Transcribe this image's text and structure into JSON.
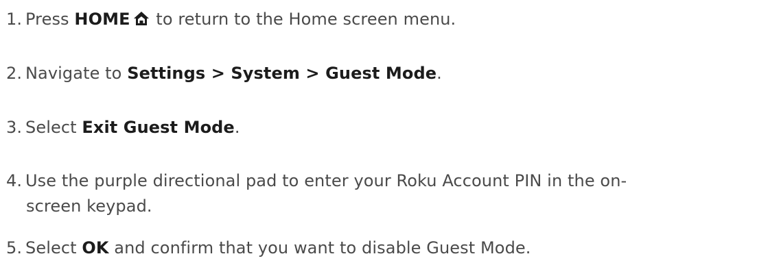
{
  "steps": [
    {
      "num": "1.",
      "pre": "Press ",
      "bold": "HOME",
      "icon": "home-icon",
      "post": " to return to the Home screen menu."
    },
    {
      "num": "2.",
      "pre": "Navigate to ",
      "bold": "Settings > System > Guest Mode",
      "post": "."
    },
    {
      "num": "3.",
      "pre": "Select ",
      "bold": "Exit Guest Mode",
      "post": "."
    },
    {
      "num": "4.",
      "text_line1": "Use the purple directional pad to enter your Roku Account PIN in the on-",
      "text_line2": "screen keypad."
    },
    {
      "num": "5.",
      "pre": "Select ",
      "bold": "OK",
      "post": " and confirm that you want to disable Guest Mode."
    }
  ]
}
